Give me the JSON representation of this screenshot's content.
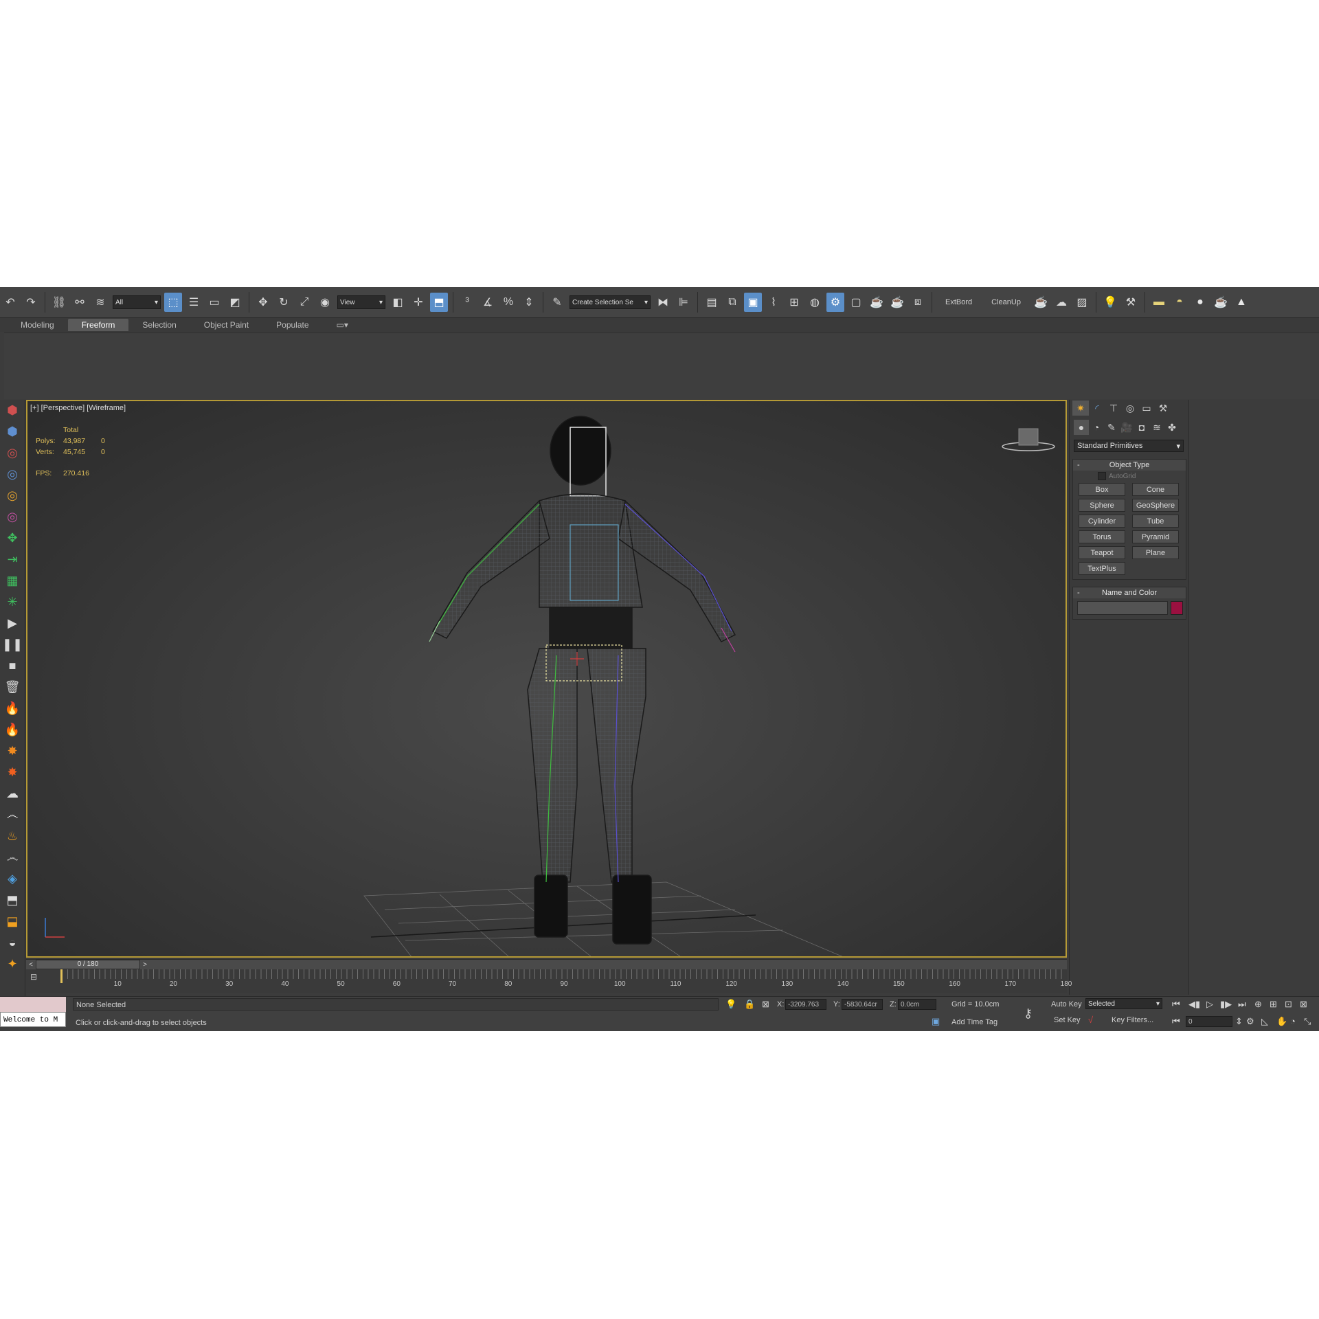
{
  "toolbar": {
    "selection_filter": "All",
    "ref_coord": "View",
    "named_selection": "Create Selection Se",
    "text_buttons": [
      "ExtBord",
      "CleanUp"
    ]
  },
  "ribbon": {
    "tabs": [
      "Modeling",
      "Freeform",
      "Selection",
      "Object Paint",
      "Populate"
    ],
    "active_tab": "Freeform"
  },
  "viewport": {
    "label": "[+] [Perspective] [Wireframe]",
    "stats": {
      "header": "Total",
      "polys_label": "Polys:",
      "polys_total": "43,987",
      "polys_sel": "0",
      "verts_label": "Verts:",
      "verts_total": "45,745",
      "verts_sel": "0",
      "fps_label": "FPS:",
      "fps_value": "270.416"
    }
  },
  "command_panel": {
    "category_dropdown": "Standard Primitives",
    "object_type_title": "Object Type",
    "autogrid_label": "AutoGrid",
    "primitives": [
      "Box",
      "Cone",
      "Sphere",
      "GeoSphere",
      "Cylinder",
      "Tube",
      "Torus",
      "Pyramid",
      "Teapot",
      "Plane",
      "TextPlus"
    ],
    "name_color_title": "Name and Color",
    "object_color": "#9a1040"
  },
  "timeline": {
    "slider_label": "0 / 180",
    "ticks": [
      "10",
      "20",
      "30",
      "40",
      "50",
      "60",
      "70",
      "80",
      "90",
      "100",
      "110",
      "120",
      "130",
      "140",
      "150",
      "160",
      "170",
      "180"
    ]
  },
  "status": {
    "maxscript_text": "Welcome to M",
    "selection_status": "None Selected",
    "prompt": "Click or click-and-drag to select objects",
    "x_label": "X:",
    "x_value": "-3209.763",
    "y_label": "Y:",
    "y_value": "-5830.64cr",
    "z_label": "Z:",
    "z_value": "0.0cm",
    "grid": "Grid = 10.0cm",
    "add_time_tag": "Add Time Tag",
    "auto_key": "Auto Key",
    "set_key": "Set Key",
    "key_mode": "Selected",
    "key_filters": "Key Filters...",
    "frame_value": "0"
  }
}
